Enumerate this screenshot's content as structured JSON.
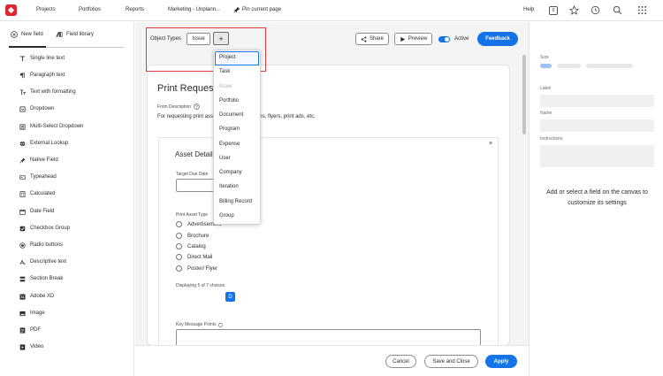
{
  "topbar": {
    "nav": [
      "Projects",
      "Portfolios",
      "Reports",
      "Marketing - Unplann..."
    ],
    "pin_label": "Pin current page",
    "help": "Help",
    "badge_count": "0"
  },
  "sidebar": {
    "tabs": [
      "New field",
      "Field library"
    ],
    "items": [
      {
        "label": "Single line text",
        "icon": "text-icon"
      },
      {
        "label": "Paragraph text",
        "icon": "paragraph-icon"
      },
      {
        "label": "Text with formatting",
        "icon": "format-text-icon"
      },
      {
        "label": "Dropdown",
        "icon": "dropdown-icon"
      },
      {
        "label": "Multi-Select Dropdown",
        "icon": "multi-select-icon"
      },
      {
        "label": "External Lookup",
        "icon": "globe-icon"
      },
      {
        "label": "Native Field",
        "icon": "pin-icon"
      },
      {
        "label": "Typeahead",
        "icon": "typeahead-icon"
      },
      {
        "label": "Calculated",
        "icon": "calculator-icon"
      },
      {
        "label": "Date Field",
        "icon": "calendar-icon"
      },
      {
        "label": "Checkbox Group",
        "icon": "checkbox-icon"
      },
      {
        "label": "Radio buttons",
        "icon": "radio-icon"
      },
      {
        "label": "Descriptive text",
        "icon": "descriptive-text-icon"
      },
      {
        "label": "Section Break",
        "icon": "section-break-icon"
      },
      {
        "label": "Adobe XD",
        "icon": "adobe-xd-icon"
      },
      {
        "label": "Image",
        "icon": "image-icon"
      },
      {
        "label": "PDF",
        "icon": "pdf-icon"
      },
      {
        "label": "Video",
        "icon": "video-icon"
      }
    ]
  },
  "toolbar": {
    "object_types_label": "Object Types",
    "issue_chip": "Issue",
    "add_symbol": "+",
    "share": "Share",
    "preview": "Preview",
    "active": "Active",
    "feedback": "Feedback"
  },
  "dropdown": {
    "items": [
      "Project",
      "Task",
      "Issue",
      "Portfolio",
      "Document",
      "Program",
      "Expense",
      "User",
      "Company",
      "Iteration",
      "Billing Record",
      "Group"
    ],
    "selected": "Project",
    "disabled": "Issue"
  },
  "form": {
    "title": "Print Request",
    "desc_label": "Form Description",
    "desc_text": "For requesting print assets such as brochures, flyers, print ads, etc.",
    "section_title": "Asset Details",
    "close_symbol": "×",
    "target_due_label": "Target Due Date",
    "print_asset_label": "Print Asset Type",
    "radio_options": [
      "Advertisement",
      "Brochure",
      "Catalog",
      "Direct Mail",
      "Poster/ Flyer"
    ],
    "displaying": "Displaying 5 of 7 choices",
    "d_badge": "D",
    "key_message_label": "Key Message Points"
  },
  "footer": {
    "cancel": "Cancel",
    "save_close": "Save and Close",
    "apply": "Apply"
  },
  "props": {
    "size_label": "Size",
    "label_label": "Label",
    "name_label": "Name",
    "instructions_label": "Instructions",
    "hint": "Add or select a field on the canvas to customize its settings"
  },
  "colors": {
    "accent": "#1473e6",
    "brand": "#e0242e",
    "highlight_border": "#e03b3b"
  }
}
